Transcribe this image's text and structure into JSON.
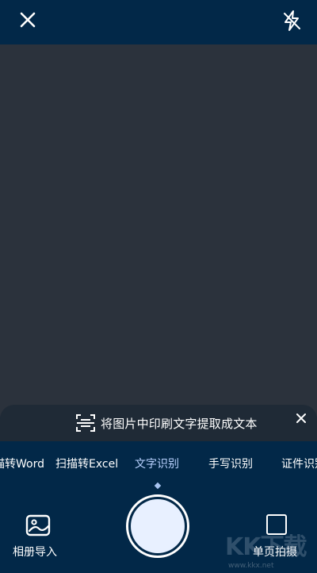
{
  "header": {
    "close_icon": "close-icon",
    "flash_icon": "flash-off-icon"
  },
  "hint": {
    "text": "将图片中印刷文字提取成文本",
    "icon": "scan-text-icon",
    "close_icon": "close-icon"
  },
  "modes": [
    {
      "label": "描转Word",
      "active": false
    },
    {
      "label": "扫描转Excel",
      "active": false
    },
    {
      "label": "文字识别",
      "active": true
    },
    {
      "label": "手写识别",
      "active": false
    },
    {
      "label": "证件识别",
      "active": false
    }
  ],
  "bottom": {
    "gallery_label": "相册导入",
    "gallery_icon": "image-icon",
    "single_label": "单页拍摄",
    "single_icon": "square-icon"
  },
  "watermark": {
    "logo_text": "KK下载",
    "url": "www.kkx.net"
  },
  "colors": {
    "background": "#022848",
    "viewfinder": "#2b323c",
    "accent": "#b9d2ff"
  }
}
